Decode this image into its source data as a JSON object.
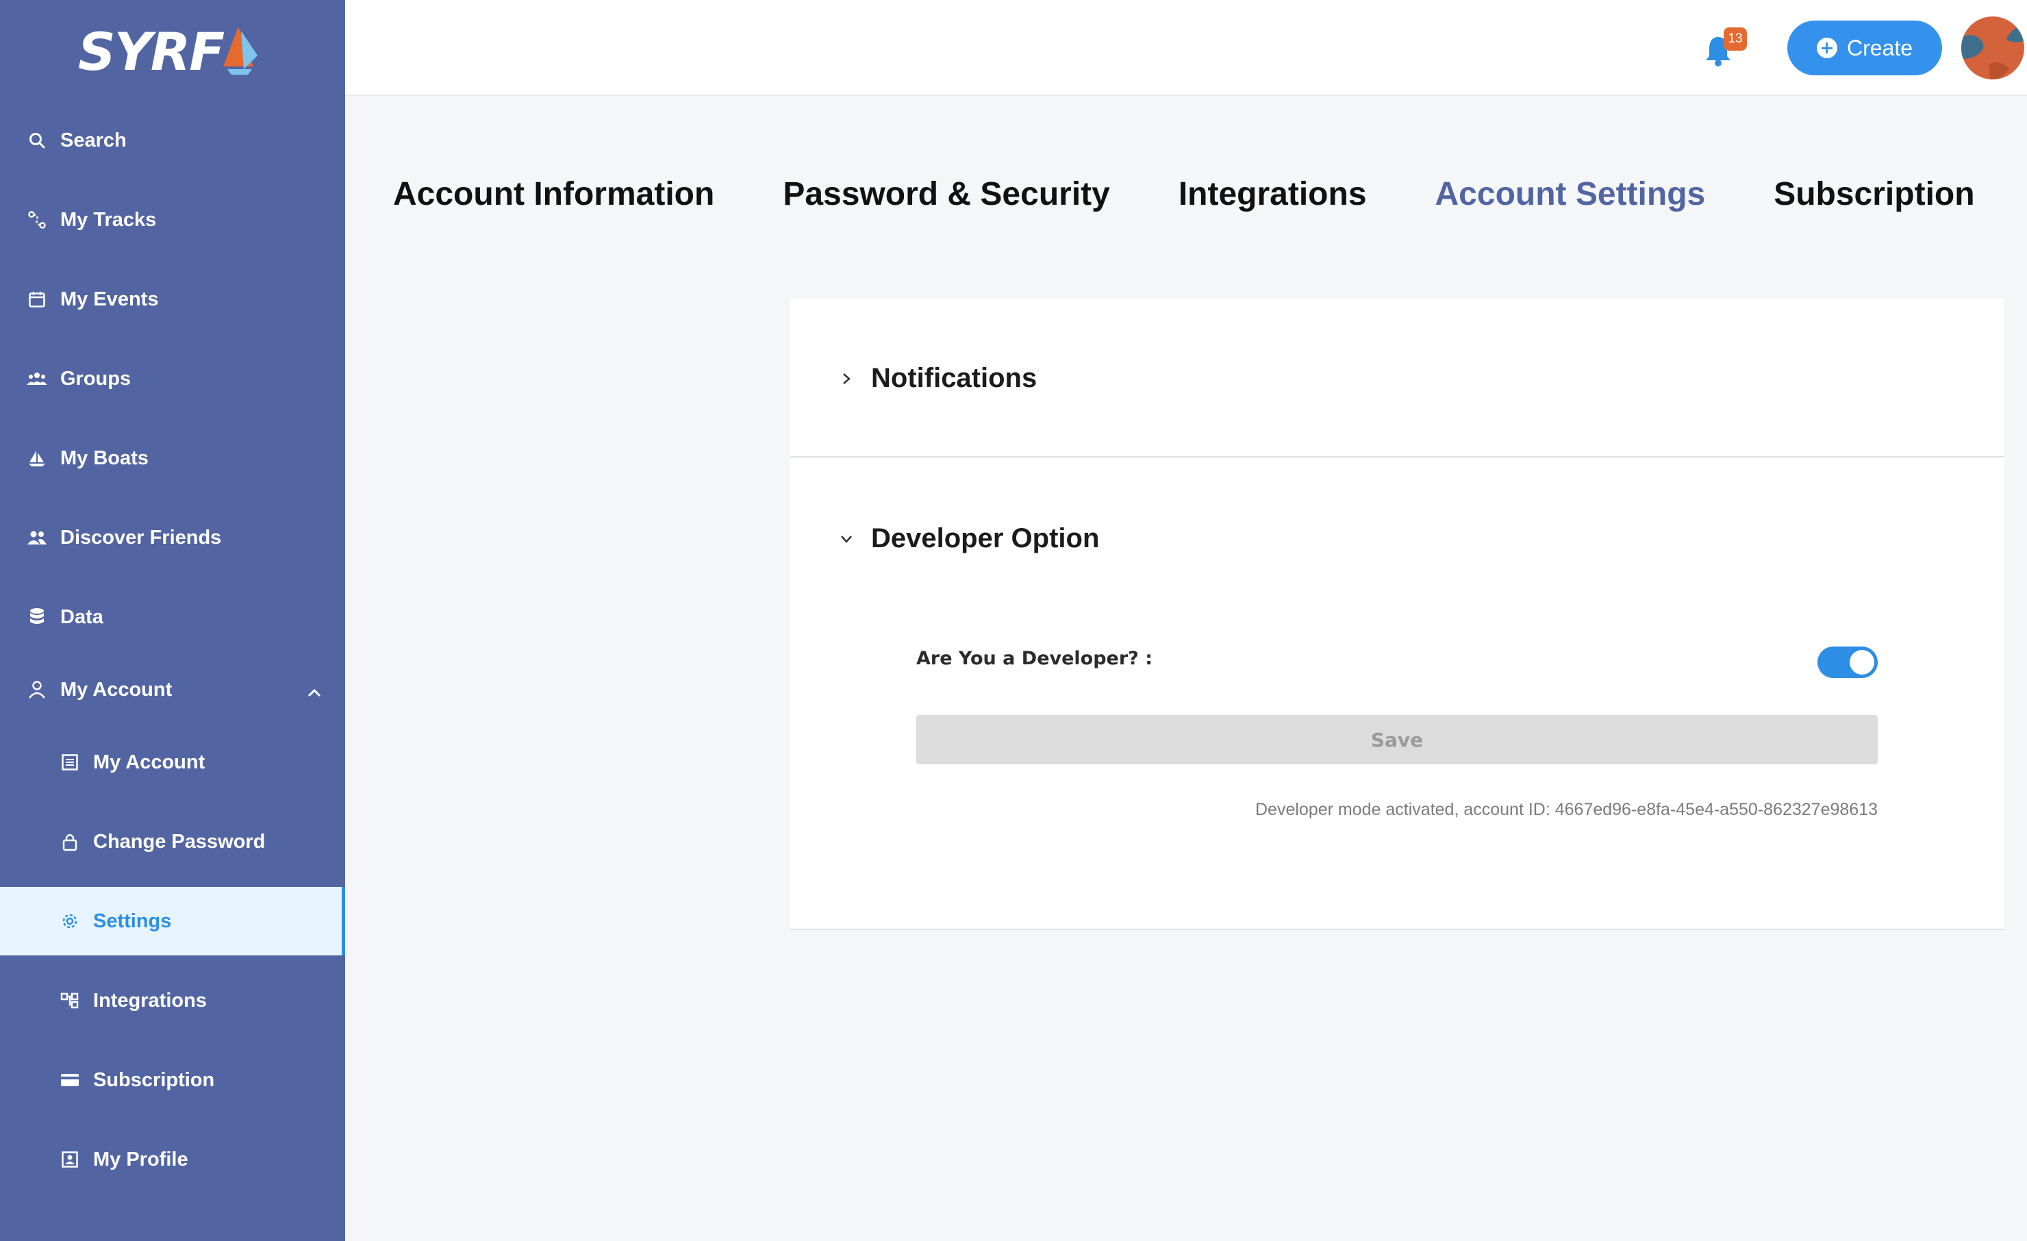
{
  "app": {
    "logo_text": "SYRF"
  },
  "sidebar": {
    "items": [
      {
        "label": "Search",
        "icon": "search-icon"
      },
      {
        "label": "My Tracks",
        "icon": "tracks-icon"
      },
      {
        "label": "My Events",
        "icon": "calendar-icon"
      },
      {
        "label": "Groups",
        "icon": "groups-icon"
      },
      {
        "label": "My Boats",
        "icon": "boat-icon"
      },
      {
        "label": "Discover Friends",
        "icon": "friends-icon"
      },
      {
        "label": "Data",
        "icon": "database-icon"
      },
      {
        "label": "My Account",
        "icon": "user-icon",
        "expanded": true
      }
    ],
    "subitems": [
      {
        "label": "My Account",
        "icon": "account-details-icon"
      },
      {
        "label": "Change Password",
        "icon": "lock-icon"
      },
      {
        "label": "Settings",
        "icon": "gear-icon",
        "active": true
      },
      {
        "label": "Integrations",
        "icon": "integrations-icon"
      },
      {
        "label": "Subscription",
        "icon": "card-icon"
      },
      {
        "label": "My Profile",
        "icon": "profile-icon"
      }
    ]
  },
  "header": {
    "notification_count": "13",
    "create_label": "Create"
  },
  "tabs": [
    {
      "label": "Account Information"
    },
    {
      "label": "Password & Security"
    },
    {
      "label": "Integrations"
    },
    {
      "label": "Account Settings",
      "active": true
    },
    {
      "label": "Subscription"
    }
  ],
  "settings": {
    "notifications_title": "Notifications",
    "developer_title": "Developer Option",
    "developer_question": "Are You a Developer? :",
    "developer_enabled": true,
    "save_label": "Save",
    "status_text": "Developer mode activated, account ID: 4667ed96-e8fa-45e4-a550-862327e98613"
  },
  "colors": {
    "sidebar_bg": "#5265a2",
    "accent": "#2d8ee6",
    "active_tab": "#5265a2",
    "badge": "#e56a2f"
  }
}
